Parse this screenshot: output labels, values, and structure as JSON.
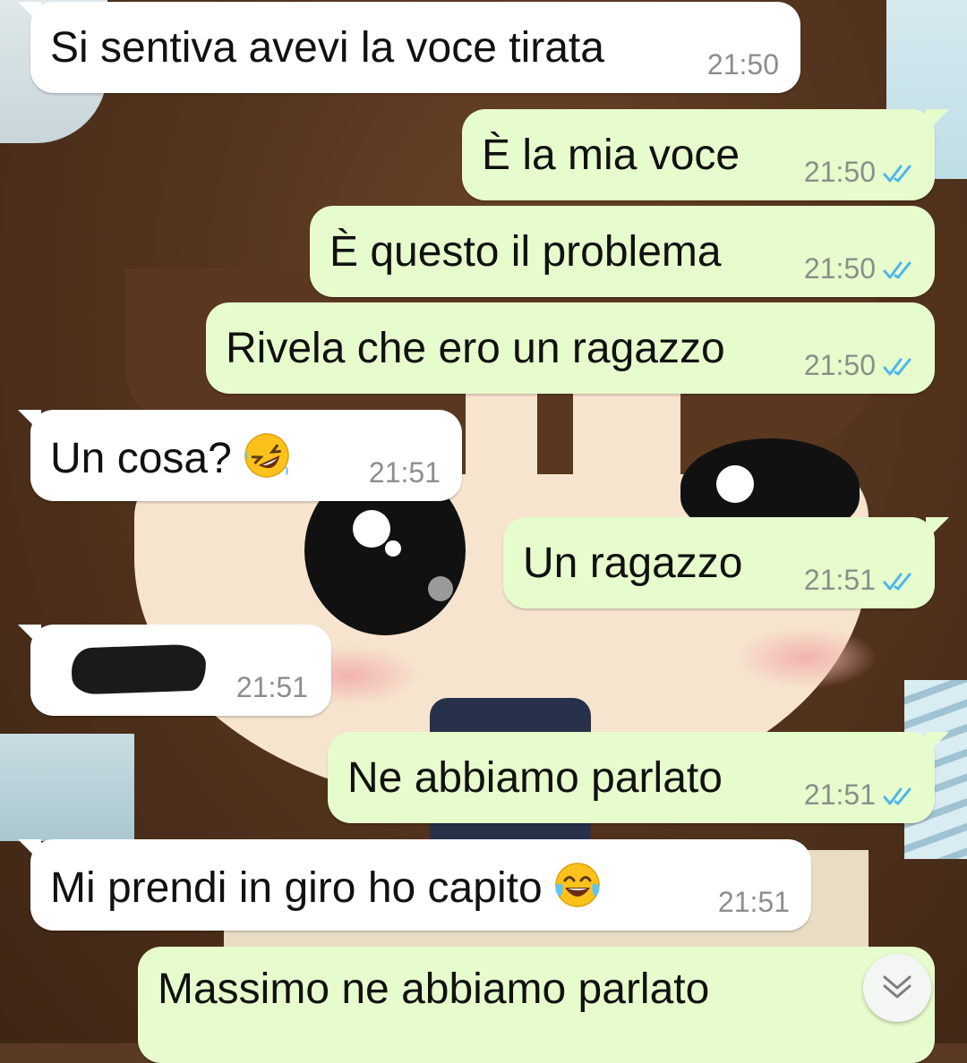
{
  "wallpaper": {
    "description_icon": "anime-girl-wallpaper"
  },
  "messages": [
    {
      "direction": "in",
      "text": "Si sentiva avevi la voce tirata",
      "time": "21:50"
    },
    {
      "direction": "out",
      "text": "È la mia voce",
      "time": "21:50",
      "status": "read"
    },
    {
      "direction": "out",
      "text": "È questo il problema",
      "time": "21:50",
      "status": "read"
    },
    {
      "direction": "out",
      "text": "Rivela che ero un ragazzo",
      "time": "21:50",
      "status": "read"
    },
    {
      "direction": "in",
      "text": "Un cosa?",
      "emoji": "rolling-on-floor-laughing",
      "time": "21:51"
    },
    {
      "direction": "out",
      "text": "Un ragazzo",
      "time": "21:51",
      "status": "read"
    },
    {
      "direction": "in",
      "text": "",
      "redacted": true,
      "time": "21:51"
    },
    {
      "direction": "out",
      "text": "Ne abbiamo parlato",
      "time": "21:51",
      "status": "read"
    },
    {
      "direction": "in",
      "text": "Mi prendi in giro ho capito",
      "emoji": "tears-of-joy",
      "time": "21:51"
    },
    {
      "direction": "out",
      "text": "Massimo ne abbiamo parlato",
      "time": "",
      "status": ""
    }
  ],
  "controls": {
    "scroll_down_icon": "chevron-double-down-icon"
  },
  "colors": {
    "incoming_bubble": "#ffffff",
    "outgoing_bubble": "#e7fccc",
    "read_ticks": "#4fb6ec",
    "timestamp": "#8a8f8a"
  }
}
